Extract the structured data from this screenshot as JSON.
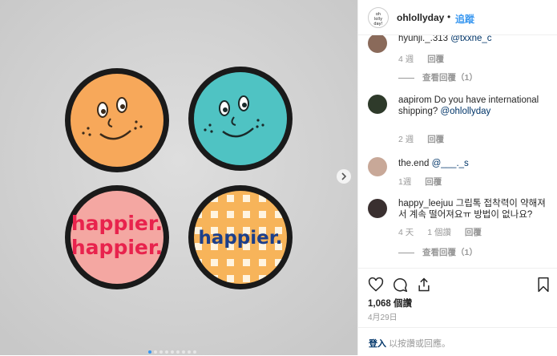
{
  "header": {
    "username": "ohlollyday",
    "separator": "•",
    "follow_label": "追蹤",
    "avatar_text": "oh lolly day"
  },
  "comments": [
    {
      "user": "hyunji._.313",
      "mention": "@txxne_c",
      "text": "",
      "time": "4 週",
      "likes": "",
      "reply": "回覆",
      "view_replies": "查看回覆（1）",
      "avatar_color": "#8a6a5a"
    },
    {
      "user": "aapirom",
      "text": "Do you have international shipping?",
      "mention": "@ohlollyday",
      "time": "2 週",
      "likes": "",
      "reply": "回覆",
      "view_replies": "",
      "avatar_color": "#2e3a2a"
    },
    {
      "user": "the.end",
      "mention": "@___._s",
      "text": "",
      "time": "1週",
      "likes": "",
      "reply": "回覆",
      "view_replies": "",
      "avatar_color": "#c8a898"
    },
    {
      "user": "happy_leejuu",
      "text": "그립톡 접착력이 약해져서 계속 떨어져요ㅠ 방법이 없나요?",
      "mention": "",
      "time": "4 天",
      "likes": "1 個讚",
      "reply": "回覆",
      "view_replies": "查看回覆（1）",
      "avatar_color": "#3a3030"
    }
  ],
  "actions": {
    "likes": "1,068 個讚",
    "date": "4月29日",
    "icons": [
      "heart-icon",
      "comment-icon",
      "share-icon",
      "bookmark-icon"
    ]
  },
  "footer": {
    "login_link": "登入",
    "login_text": "以按讚或回應。"
  },
  "photo": {
    "badges": [
      {
        "color": "#f7a85a",
        "type": "face"
      },
      {
        "color": "#4fc3c3",
        "type": "face"
      },
      {
        "color": "#f4a7a2",
        "type": "text",
        "lines": [
          "happier.",
          "happier."
        ],
        "text_color": "#e8234d"
      },
      {
        "color": "#f7b45a",
        "type": "text",
        "lines": [
          "happier."
        ],
        "text_color": "#1c3f8a"
      }
    ],
    "carousel_count": 9,
    "carousel_active": 1
  }
}
